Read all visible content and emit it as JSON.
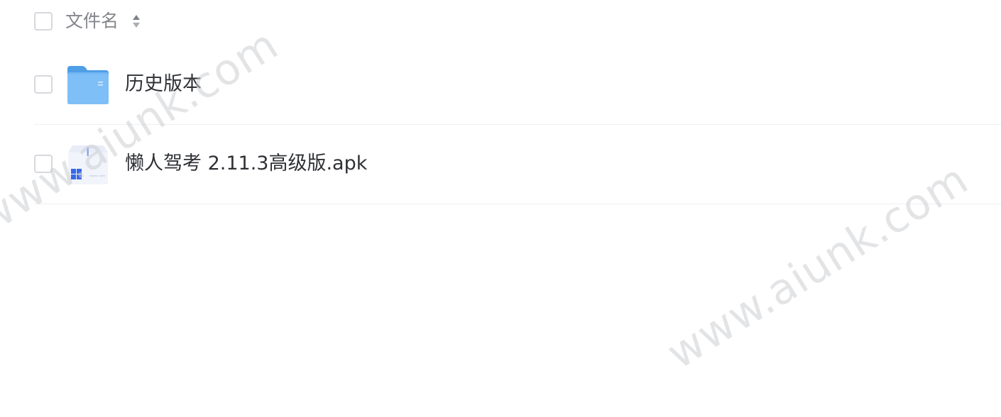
{
  "file_list": {
    "header": {
      "column_label": "文件名",
      "select_all_icon": "checkbox-unchecked",
      "sort_icon": "sort-updown-icon"
    },
    "rows": [
      {
        "name": "历史版本",
        "icon": "folder-icon",
        "checkbox_icon": "checkbox-unchecked"
      },
      {
        "name": "懒人驾考 2.11.3高级版.apk",
        "icon": "apk-file-icon",
        "checkbox_icon": "checkbox-unchecked"
      }
    ]
  },
  "watermarks": [
    "www.aiunk.com",
    "www.aiunk.com"
  ],
  "colors": {
    "header_text": "#84868c",
    "file_name_text": "#2f3136",
    "checkbox_border": "#d6d8dd",
    "row_divider": "#eeeff2",
    "folder_blue": "#5aa8f2",
    "apk_blue": "#3868e8",
    "watermark": "#c8cace"
  }
}
